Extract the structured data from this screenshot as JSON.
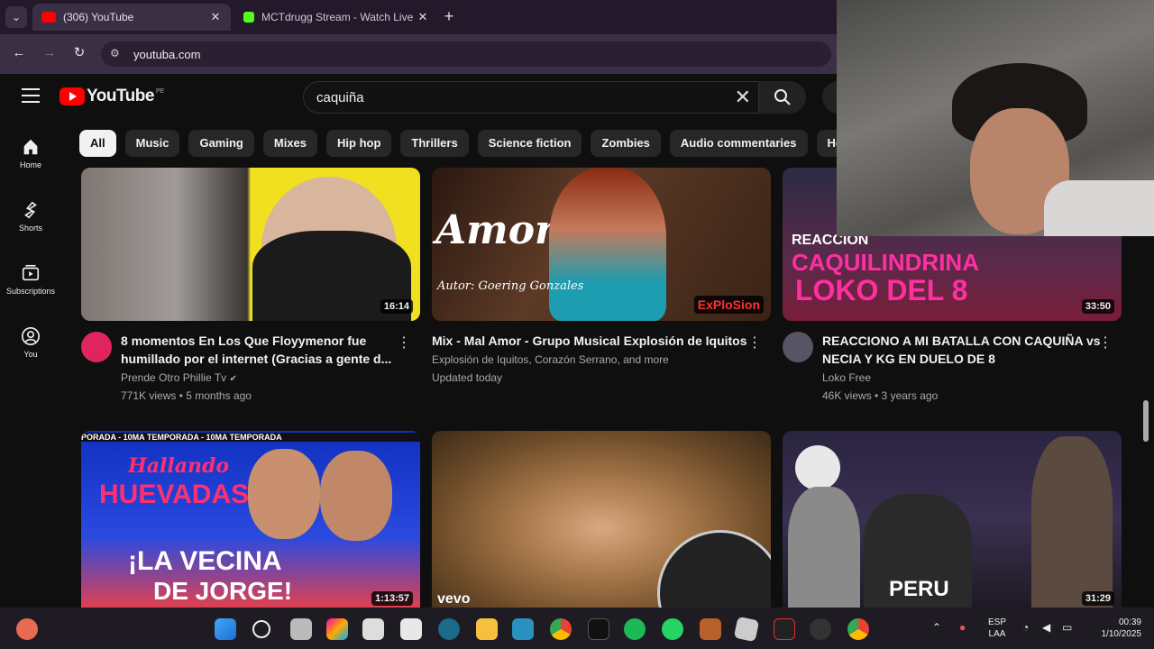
{
  "browser": {
    "tabs": [
      {
        "title": "(306) YouTube",
        "active": true
      },
      {
        "title": "MCTdrugg Stream - Watch Live",
        "active": false
      }
    ],
    "url": "youtuba.com"
  },
  "youtube": {
    "logo_text": "YouTube",
    "logo_country": "PE",
    "search_query": "caquiña",
    "sidebar": [
      {
        "label": "Home",
        "icon": "home-icon"
      },
      {
        "label": "Shorts",
        "icon": "shorts-icon"
      },
      {
        "label": "Subscriptions",
        "icon": "subscriptions-icon"
      },
      {
        "label": "You",
        "icon": "user-icon"
      }
    ],
    "chips": [
      "All",
      "Music",
      "Gaming",
      "Mixes",
      "Hip hop",
      "Thrillers",
      "Science fiction",
      "Zombies",
      "Audio commentaries",
      "Heroes"
    ],
    "videos": [
      {
        "title": "8 momentos En Los Que Floyymenor fue humillado por el internet (Gracias a gente d...",
        "channel": "Prende Otro Phillie Tv",
        "verified": true,
        "stats": "771K views • 5 months ago",
        "duration": "16:14",
        "avatar_color": "#e0245e"
      },
      {
        "title": "Mix - Mal Amor - Grupo Musical Explosión de Iquitos",
        "channel": "Explosión de Iquitos, Corazón Serrano, and more",
        "verified": false,
        "stats": "Updated today",
        "duration": "",
        "thumb_text": "Amor",
        "thumb_sub": "Autor: Goering Gonzales",
        "avatar_color": ""
      },
      {
        "title": "REACCIONO A MI BATALLA CON CAQUIÑA vs NECIA Y KG EN DUELO DE 8",
        "channel": "Loko Free",
        "verified": false,
        "stats": "46K views • 3 years ago",
        "duration": "33:50",
        "thumb_text1": "REACCION",
        "thumb_text2": "CAQUILINDRINA",
        "thumb_text3": "LOKO DEL 8",
        "avatar_color": "#556"
      },
      {
        "title": "",
        "channel": "",
        "stats": "",
        "duration": "1:13:57",
        "thumb_text1": "Hallando",
        "thumb_text2": "HUEVADAS",
        "thumb_text3": "¡LA VECINA",
        "thumb_text4": "DE JORGE!",
        "thumb_banner": "PORADA - 10MA TEMPORADA - 10MA TEMPORADA"
      },
      {
        "title": "",
        "channel": "",
        "stats": "",
        "duration": "",
        "thumb_text1": "vevo"
      },
      {
        "title": "",
        "channel": "",
        "stats": "",
        "duration": "31:29",
        "thumb_text1": "PERU"
      }
    ]
  },
  "taskbar": {
    "lang_top": "ESP",
    "lang_bottom": "LAA",
    "time": "00:39",
    "date": "1/10/2025"
  },
  "colors": {
    "youtube_red": "#ff0000",
    "bg": "#0f0f0f",
    "chip_bg": "#272727",
    "meta_text": "#aaaaaa"
  }
}
